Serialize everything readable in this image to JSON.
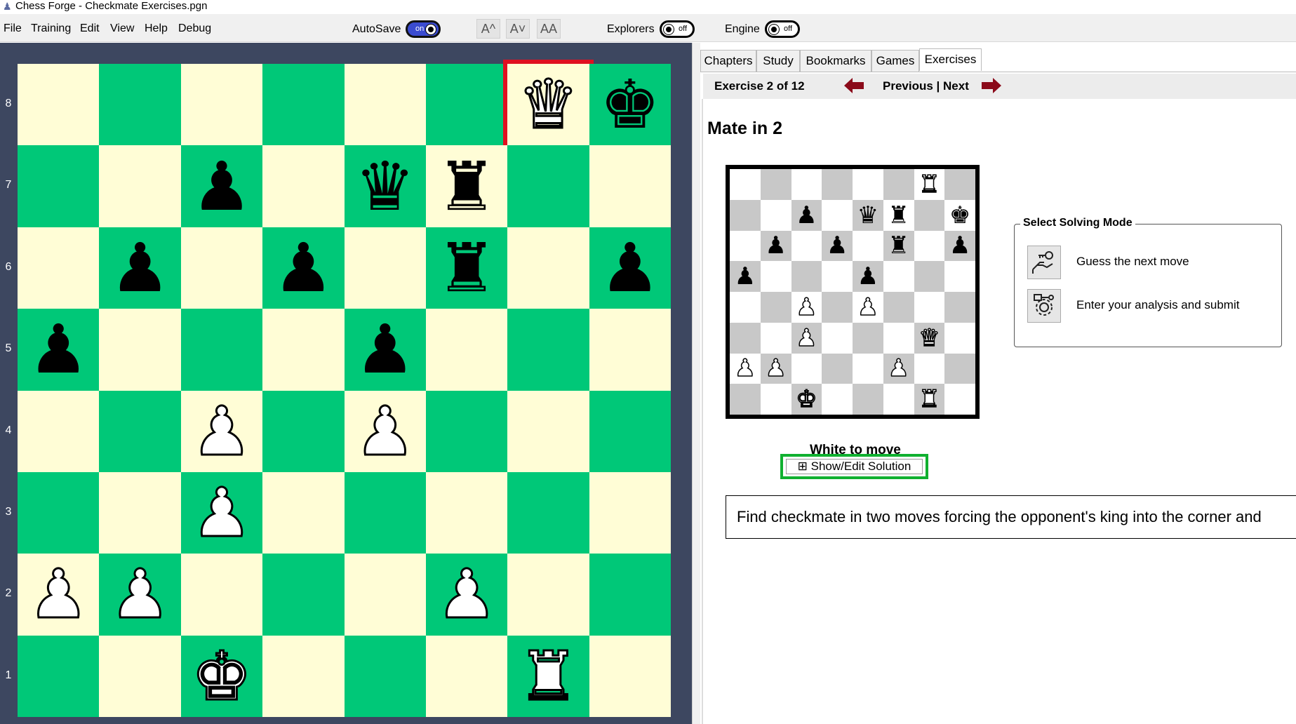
{
  "window": {
    "title": "Chess Forge - Checkmate Exercises.pgn"
  },
  "menu": {
    "items": [
      "File",
      "Training",
      "Edit",
      "View",
      "Help",
      "Debug"
    ],
    "autosave_label": "AutoSave",
    "autosave_state": "on",
    "font_buttons": [
      "A^",
      "A˅",
      "AA"
    ],
    "explorers_label": "Explorers",
    "explorers_state": "off",
    "engine_label": "Engine",
    "engine_state": "off"
  },
  "board": {
    "rank_labels": [
      "8",
      "7",
      "6",
      "5",
      "4",
      "3",
      "2",
      "1"
    ],
    "highlighted_square": "g8",
    "colors": {
      "light": "#fffdd6",
      "dark": "#00c878",
      "highlight": "#e01020"
    },
    "position": [
      [
        "",
        "",
        "",
        "",
        "",
        "",
        "wQ",
        "bK"
      ],
      [
        "",
        "",
        "bP",
        "",
        "bQ",
        "bR",
        "",
        ""
      ],
      [
        "",
        "bP",
        "",
        "bP",
        "",
        "bR",
        "",
        "bP"
      ],
      [
        "bP",
        "",
        "",
        "",
        "bP",
        "",
        "",
        ""
      ],
      [
        "",
        "",
        "wP",
        "",
        "wP",
        "",
        "",
        ""
      ],
      [
        "",
        "",
        "wP",
        "",
        "",
        "",
        "",
        ""
      ],
      [
        "wP",
        "wP",
        "",
        "",
        "",
        "wP",
        "",
        ""
      ],
      [
        "",
        "",
        "wK",
        "",
        "",
        "",
        "wR",
        ""
      ]
    ]
  },
  "tabs": [
    {
      "label": "Chapters",
      "active": false
    },
    {
      "label": "Study",
      "active": false
    },
    {
      "label": "Bookmarks",
      "active": false
    },
    {
      "label": "Games",
      "active": false
    },
    {
      "label": "Exercises",
      "active": true
    }
  ],
  "exercise": {
    "counter": "Exercise 2 of 12",
    "previous_label": "Previous",
    "separator": " | ",
    "next_label": "Next",
    "title": "Mate in 2",
    "to_move": "White to move",
    "solution_button": "⊞ Show/Edit Solution",
    "description": "Find checkmate in two moves forcing the opponent's king into the corner and",
    "mini_position": [
      [
        "",
        "",
        "",
        "",
        "",
        "",
        "wR",
        ""
      ],
      [
        "",
        "",
        "bP",
        "",
        "bQ",
        "bR",
        "",
        "bK"
      ],
      [
        "",
        "bP",
        "",
        "bP",
        "",
        "bR",
        "",
        "bP"
      ],
      [
        "bP",
        "",
        "",
        "",
        "bP",
        "",
        "",
        ""
      ],
      [
        "",
        "",
        "wP",
        "",
        "wP",
        "",
        "",
        ""
      ],
      [
        "",
        "",
        "wP",
        "",
        "",
        "",
        "wQ",
        ""
      ],
      [
        "wP",
        "wP",
        "",
        "",
        "",
        "wP",
        "",
        ""
      ],
      [
        "",
        "",
        "wK",
        "",
        "",
        "",
        "wR",
        ""
      ]
    ]
  },
  "solving_mode": {
    "legend": "Select Solving Mode",
    "options": [
      {
        "label": "Guess the next move",
        "icon": "hand-key-icon"
      },
      {
        "label": "Enter your analysis and submit",
        "icon": "gear-analysis-icon"
      }
    ]
  },
  "accent_colors": {
    "nav_arrow": "#8b0a1a",
    "solution_frame": "#10b030",
    "toggle_on": "#3a4bd0"
  }
}
